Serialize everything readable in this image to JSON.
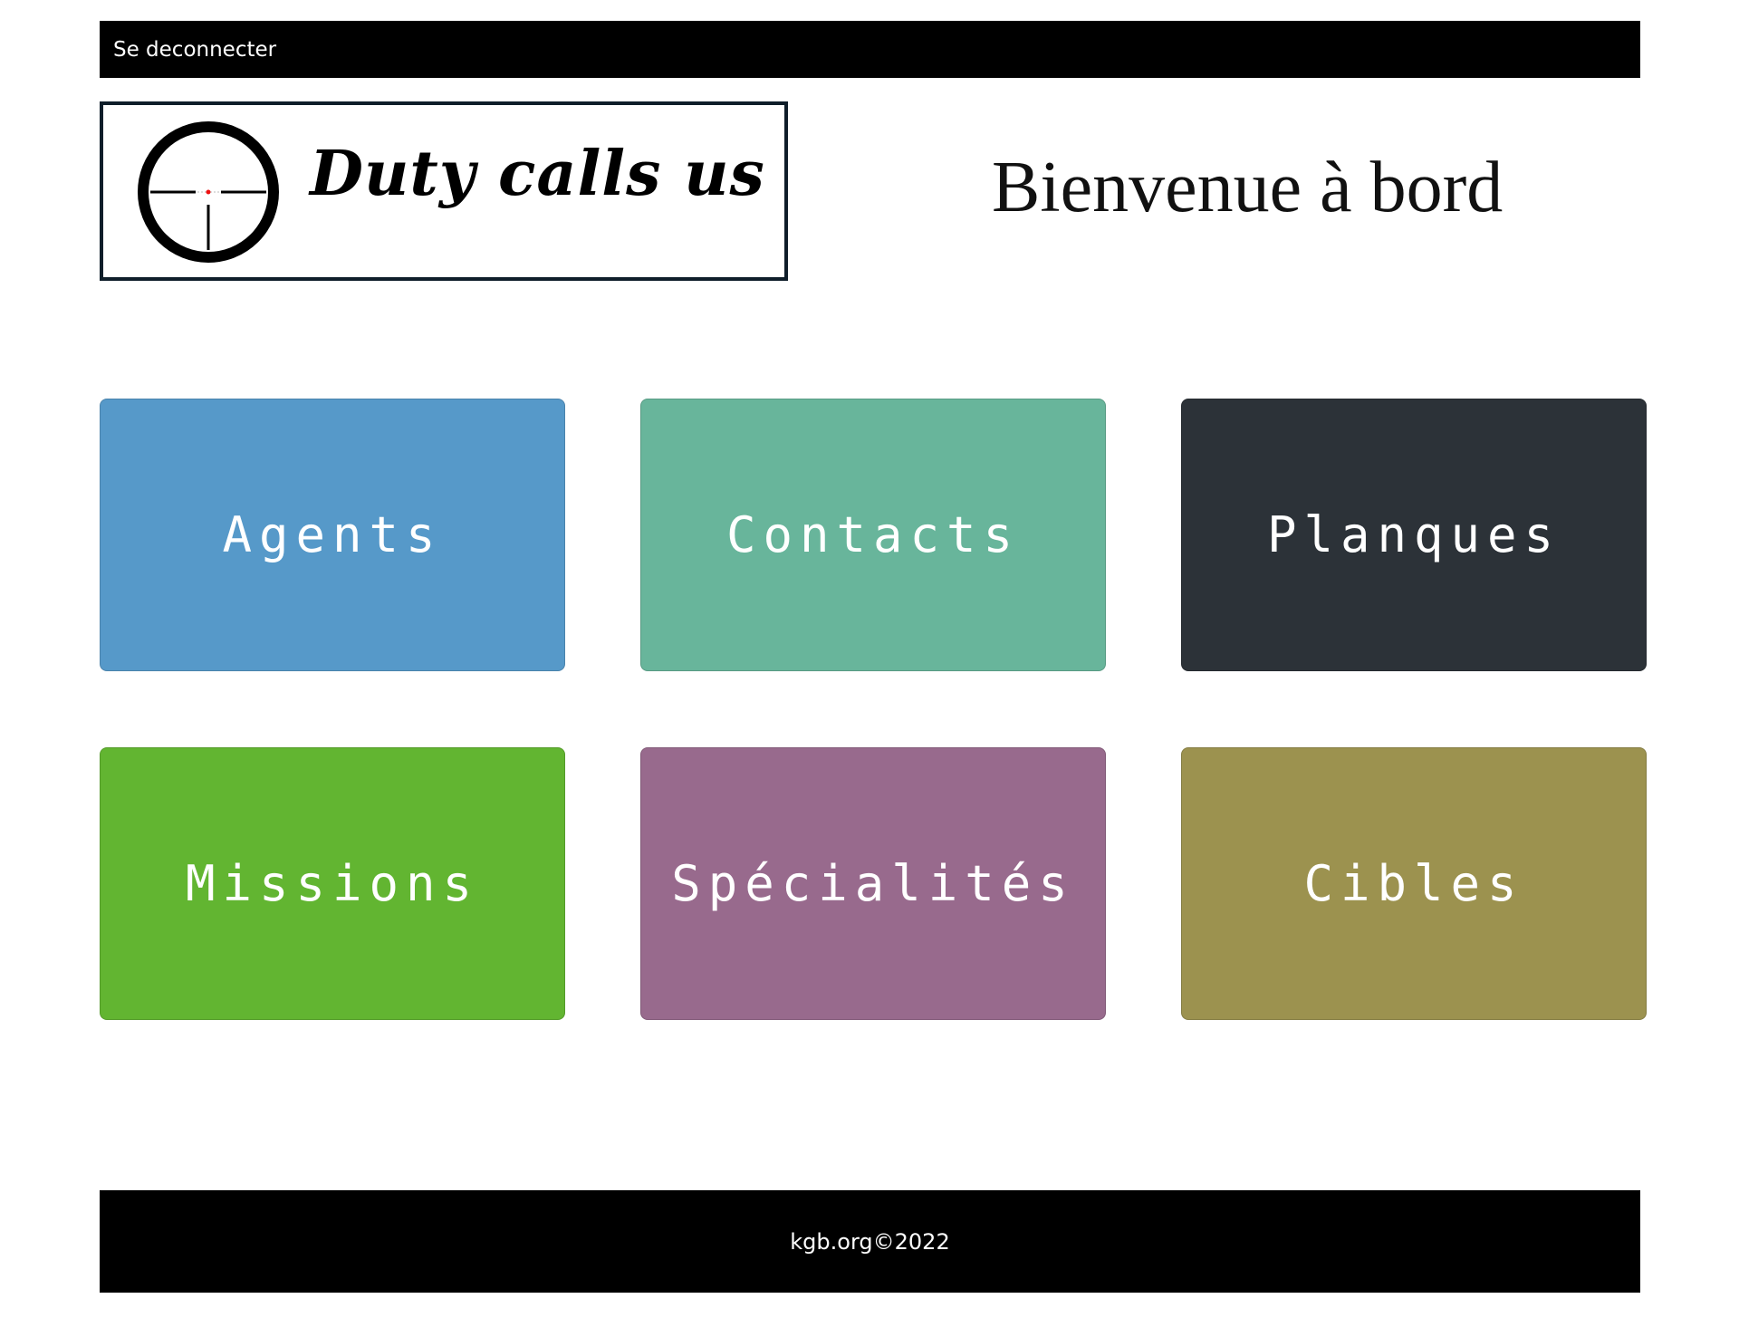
{
  "topbar": {
    "logout_label": "Se deconnecter"
  },
  "logo": {
    "text": "Duty calls us",
    "icon": "crosshair-icon"
  },
  "welcome": "Bienvenue à bord",
  "tiles": [
    {
      "label": "Agents",
      "color": "#5699c9"
    },
    {
      "label": "Contacts",
      "color": "#68b59b"
    },
    {
      "label": "Planques",
      "color": "#2c3238"
    },
    {
      "label": "Missions",
      "color": "#62b531"
    },
    {
      "label": "Spécialités",
      "color": "#986a8d"
    },
    {
      "label": "Cibles",
      "color": "#9c924f"
    }
  ],
  "footer": {
    "text": "kgb.org©2022"
  }
}
